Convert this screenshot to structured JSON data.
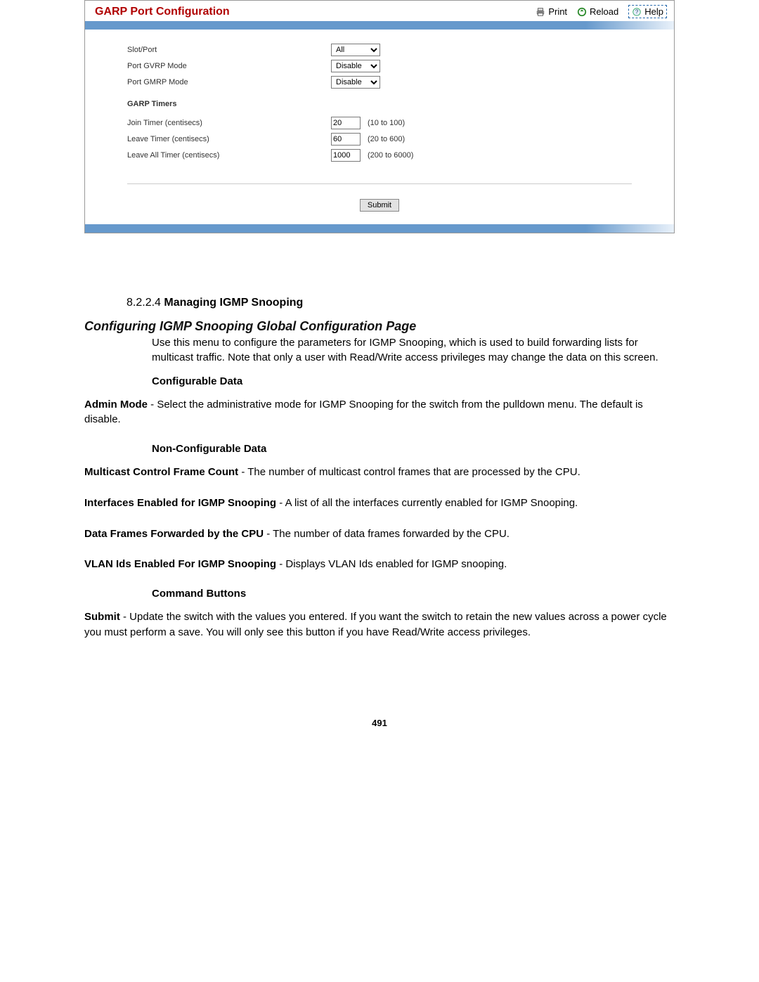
{
  "panel": {
    "title": "GARP Port Configuration",
    "actions": {
      "print": "Print",
      "reload": "Reload",
      "help": "Help"
    },
    "fields": {
      "slot_port": {
        "label": "Slot/Port",
        "value": "All"
      },
      "gvrp_mode": {
        "label": "Port GVRP Mode",
        "value": "Disable"
      },
      "gmrp_mode": {
        "label": "Port GMRP Mode",
        "value": "Disable"
      }
    },
    "timers_head": "GARP Timers",
    "timers": {
      "join": {
        "label": "Join Timer (centisecs)",
        "value": "20",
        "range": "(10 to 100)"
      },
      "leave": {
        "label": "Leave Timer (centisecs)",
        "value": "60",
        "range": "(20 to 600)"
      },
      "leave_all": {
        "label": "Leave All Timer (centisecs)",
        "value": "1000",
        "range": "(200 to 6000)"
      }
    },
    "submit": "Submit"
  },
  "doc": {
    "sec_num": "8.2.2.4",
    "sec_title": "Managing IGMP Snooping",
    "page_head": "Configuring IGMP Snooping Global Configuration Page",
    "intro": "Use this menu to configure the parameters for IGMP Snooping, which is used to build forwarding lists for multicast traffic. Note that only a user with Read/Write access privileges may change the data on this screen.",
    "cfg_head": "Configurable Data",
    "admin_mode_term": "Admin Mode",
    "admin_mode_body": " - Select the administrative mode for IGMP Snooping for the switch from the pulldown menu. The default is disable.",
    "noncfg_head": "Non-Configurable Data",
    "mcast_term": "Multicast Control Frame Count",
    "mcast_body": " - The number of multicast control frames that are processed by the CPU.",
    "ifaces_term": "Interfaces Enabled for IGMP Snooping",
    "ifaces_body": " - A list of all the interfaces currently enabled for IGMP Snooping.",
    "dataframes_term": "Data Frames Forwarded by the CPU",
    "dataframes_body": " - The number of data frames forwarded by the CPU.",
    "vlan_term": "VLAN Ids Enabled For IGMP Snooping",
    "vlan_body": " - Displays VLAN Ids enabled for IGMP snooping.",
    "cmd_head": "Command Buttons",
    "submit_term": "Submit",
    "submit_body": " - Update the switch with the values you entered. If you want the switch to retain the new values across a power cycle you must perform a save. You will only see this button if you have Read/Write access privileges.",
    "page_number": "491"
  }
}
